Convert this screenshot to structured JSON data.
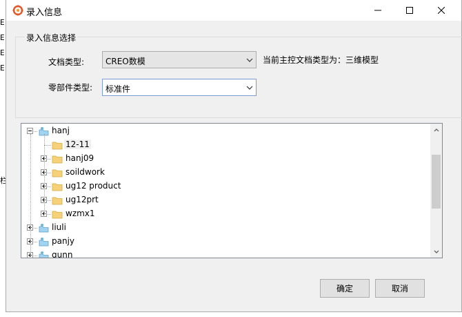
{
  "window": {
    "title": "录入信息",
    "icons": {
      "app": "app-logo-icon",
      "minimize": "minimize-icon",
      "maximize": "maximize-icon",
      "close": "close-icon"
    }
  },
  "background_fragments": [
    "E",
    "E",
    "E",
    "E",
    "栏"
  ],
  "group": {
    "legend": "录入信息选择",
    "doc_type_label": "文档类型:",
    "doc_type_value": "CREO数模",
    "part_type_label": "零部件类型:",
    "part_type_value": "标准件",
    "current_doc_hint": "当前主控文档类型为：三维模型"
  },
  "tree": {
    "nodes": [
      {
        "label": "hanj",
        "level": 0,
        "expander": "minus",
        "icon": "user-folder-icon"
      },
      {
        "label": "12-11",
        "level": 1,
        "expander": "none",
        "icon": "folder-icon",
        "selected": true
      },
      {
        "label": "hanj09",
        "level": 1,
        "expander": "plus",
        "icon": "folder-icon"
      },
      {
        "label": "soildwork",
        "level": 1,
        "expander": "plus",
        "icon": "folder-icon"
      },
      {
        "label": "ug12 product",
        "level": 1,
        "expander": "plus",
        "icon": "folder-icon"
      },
      {
        "label": "ug12prt",
        "level": 1,
        "expander": "plus",
        "icon": "folder-icon"
      },
      {
        "label": "wzmx1",
        "level": 1,
        "expander": "plus",
        "icon": "folder-icon"
      },
      {
        "label": "liuli",
        "level": 0,
        "expander": "plus",
        "icon": "user-folder-icon"
      },
      {
        "label": "panjy",
        "level": 0,
        "expander": "plus",
        "icon": "user-folder-icon"
      },
      {
        "label": "qunn",
        "level": 0,
        "expander": "plus",
        "icon": "user-folder-icon"
      }
    ]
  },
  "buttons": {
    "ok": "确定",
    "cancel": "取消"
  },
  "colors": {
    "dialog_bg": "#f0f0f0",
    "folder": "#f5d27a",
    "accent_border": "#7a9cd3"
  }
}
